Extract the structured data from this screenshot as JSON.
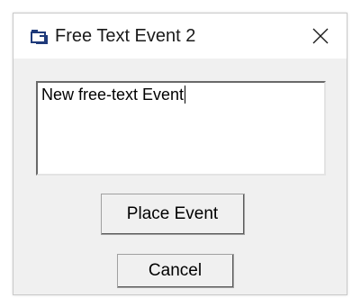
{
  "window": {
    "title": "Free Text Event 2",
    "icon": "event-window-icon",
    "close_icon": "close-icon"
  },
  "editor": {
    "value": "New free-text Event"
  },
  "buttons": {
    "place_label": "Place Event",
    "cancel_label": "Cancel"
  },
  "colors": {
    "dialog_bg": "#f0f0f0",
    "titlebar_bg": "#ffffff",
    "icon_blue": "#1f3a7a"
  }
}
